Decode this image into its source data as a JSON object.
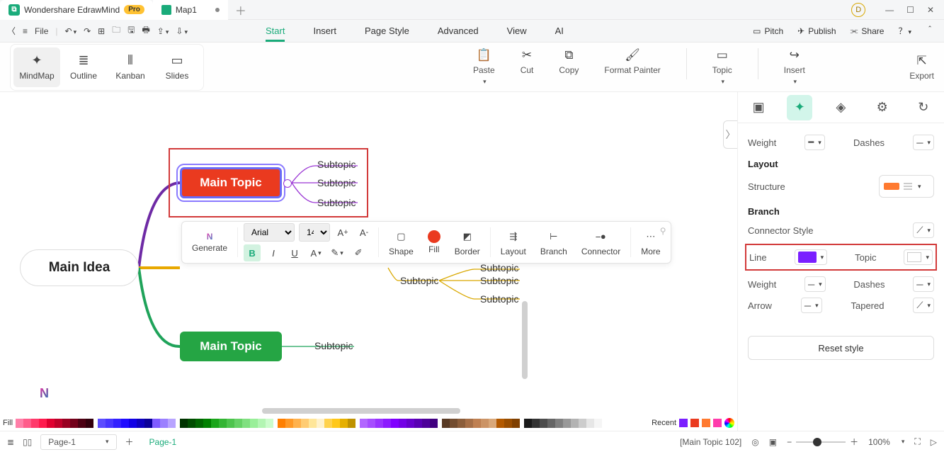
{
  "titlebar": {
    "app_name": "Wondershare EdrawMind",
    "pro_badge": "Pro",
    "doc_name": "Map1",
    "avatar_letter": "D"
  },
  "menubar": {
    "file_label": "File",
    "tabs": [
      "Start",
      "Insert",
      "Page Style",
      "Advanced",
      "View",
      "AI"
    ],
    "right": {
      "pitch": "Pitch",
      "publish": "Publish",
      "share": "Share"
    }
  },
  "ribbon": {
    "views": [
      "MindMap",
      "Outline",
      "Kanban",
      "Slides"
    ],
    "actions": {
      "paste": "Paste",
      "cut": "Cut",
      "copy": "Copy",
      "format_painter": "Format Painter",
      "topic": "Topic",
      "insert": "Insert",
      "export": "Export"
    }
  },
  "canvas": {
    "main_idea": "Main Idea",
    "main_topic": "Main Topic",
    "subtopic": "Subtopic"
  },
  "float_toolbar": {
    "generate": "Generate",
    "font_name": "Arial",
    "font_size": "14",
    "shape": "Shape",
    "fill": "Fill",
    "border": "Border",
    "layout": "Layout",
    "branch": "Branch",
    "connector": "Connector",
    "more": "More"
  },
  "right_panel": {
    "weight": "Weight",
    "dashes": "Dashes",
    "layout": "Layout",
    "structure": "Structure",
    "branch": "Branch",
    "connector_style": "Connector Style",
    "line": "Line",
    "topic": "Topic",
    "arrow": "Arrow",
    "tapered": "Tapered",
    "reset": "Reset style"
  },
  "color_bar": {
    "fill": "Fill",
    "recent": "Recent"
  },
  "statusbar": {
    "page_selector": "Page-1",
    "page_tab": "Page-1",
    "selection": "[Main Topic 102]",
    "zoom": "100%"
  }
}
